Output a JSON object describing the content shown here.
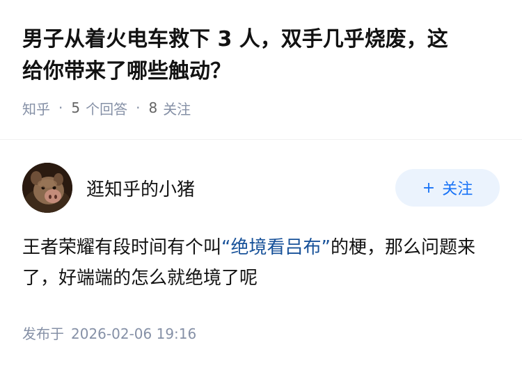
{
  "question": {
    "title": "男子从着火电车救下 3 人，双手几乎烧废，这给你带来了哪些触动？",
    "source": "知乎",
    "answer_count": "5",
    "answer_label": "个回答",
    "follow_count": "8",
    "follow_label": "关注"
  },
  "author": {
    "name": "逛知乎的小猪",
    "follow_button": "关注",
    "follow_icon": "plus-icon"
  },
  "answer": {
    "text_before": "王者荣耀有段时间有个叫",
    "highlight": "“绝境看吕布”",
    "text_after": "的梗，那么问题来了，好端端的怎么就绝境了呢"
  },
  "published": {
    "label": "发布于",
    "time": "2026-02-06 19:16"
  },
  "colors": {
    "accent": "#1772f6",
    "highlight": "#175199",
    "meta": "#8590a6",
    "button_bg": "#ebf3fd"
  }
}
